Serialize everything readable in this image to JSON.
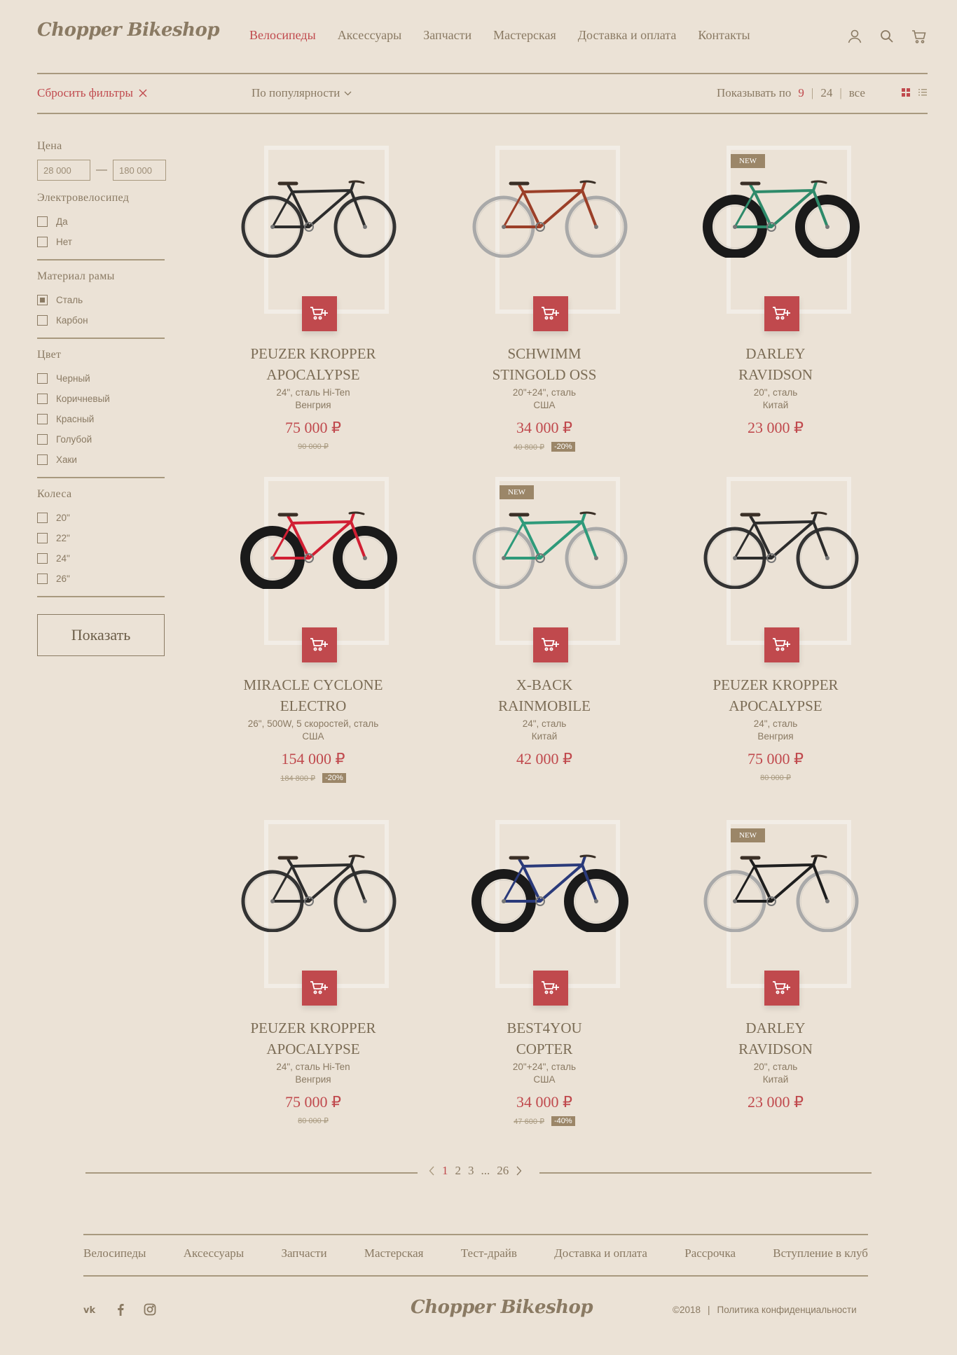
{
  "header": {
    "logo": "Chopper Bikeshop",
    "nav": [
      {
        "label": "Велосипеды",
        "active": true
      },
      {
        "label": "Аксессуары",
        "active": false
      },
      {
        "label": "Запчасти",
        "active": false
      },
      {
        "label": "Мастерская",
        "active": false
      },
      {
        "label": "Доставка и оплата",
        "active": false
      },
      {
        "label": "Контакты",
        "active": false
      }
    ],
    "icons": [
      "user-icon",
      "search-icon",
      "cart-icon"
    ]
  },
  "toolbar": {
    "reset_label": "Сбросить фильтры",
    "sort_label": "По популярности",
    "per_page_label": "Показывать по",
    "per_page_options": [
      "9",
      "24",
      "все"
    ],
    "per_page_active": "9",
    "view_modes": [
      "grid-view-icon",
      "list-view-icon"
    ]
  },
  "filters": {
    "price": {
      "title": "Цена",
      "min": "28 000",
      "max": "180 000"
    },
    "electric": {
      "title": "Электровелосипед",
      "options": [
        {
          "label": "Да",
          "checked": false
        },
        {
          "label": "Нет",
          "checked": false
        }
      ]
    },
    "frame": {
      "title": "Материал рамы",
      "options": [
        {
          "label": "Сталь",
          "checked": true
        },
        {
          "label": "Карбон",
          "checked": false
        }
      ]
    },
    "color": {
      "title": "Цвет",
      "options": [
        {
          "label": "Черный",
          "checked": false
        },
        {
          "label": "Коричневый",
          "checked": false
        },
        {
          "label": "Красный",
          "checked": false
        },
        {
          "label": "Голубой",
          "checked": false
        },
        {
          "label": "Хаки",
          "checked": false
        }
      ]
    },
    "wheels": {
      "title": "Колеса",
      "options": [
        {
          "label": "20\"",
          "checked": false
        },
        {
          "label": "22\"",
          "checked": false
        },
        {
          "label": "24\"",
          "checked": false
        },
        {
          "label": "26\"",
          "checked": false
        }
      ]
    },
    "show_button": "Показать"
  },
  "products": [
    {
      "name1": "PEUZER KROPPER",
      "name2": "APOCALYPSE",
      "spec1": "24\", сталь Hi-Ten",
      "spec2": "Венгрия",
      "price": "75 000 ₽",
      "old_price": "90 000 ₽",
      "discount": "",
      "new": false,
      "frame_color": "#2c2c2c",
      "tire_color": "#333333",
      "fat": false
    },
    {
      "name1": "SCHWIMM",
      "name2": "STINGOLD OSS",
      "spec1": "20\"+24\", сталь",
      "spec2": "США",
      "price": "34 000 ₽",
      "old_price": "40 800 ₽",
      "discount": "-20%",
      "new": false,
      "frame_color": "#9b3f28",
      "tire_color": "#a9a9a9",
      "fat": false
    },
    {
      "name1": "DARLEY",
      "name2": "RAVIDSON",
      "spec1": "20\", сталь",
      "spec2": "Китай",
      "price": "23 000 ₽",
      "old_price": "",
      "discount": "",
      "new": true,
      "frame_color": "#2e8a6a",
      "tire_color": "#1a1a1a",
      "fat": true
    },
    {
      "name1": "MIRACLE CYCLONE",
      "name2": "ELECTRO",
      "spec1": "26\", 500W, 5 скоростей, сталь",
      "spec2": "США",
      "price": "154 000 ₽",
      "old_price": "184 800 ₽",
      "discount": "-20%",
      "new": false,
      "frame_color": "#d11f33",
      "tire_color": "#1a1a1a",
      "fat": true
    },
    {
      "name1": "X-BACK",
      "name2": "RAINMOBILE",
      "spec1": "24\", сталь",
      "spec2": "Китай",
      "price": "42 000 ₽",
      "old_price": "",
      "discount": "",
      "new": true,
      "frame_color": "#2e9a7a",
      "tire_color": "#a9a9a9",
      "fat": false
    },
    {
      "name1": "PEUZER KROPPER",
      "name2": "APOCALYPSE",
      "spec1": "24\", сталь",
      "spec2": "Венгрия",
      "price": "75 000 ₽",
      "old_price": "80 000 ₽",
      "discount": "",
      "new": false,
      "frame_color": "#2c2c2c",
      "tire_color": "#333333",
      "fat": false
    },
    {
      "name1": "PEUZER KROPPER",
      "name2": "APOCALYPSE",
      "spec1": "24\", сталь Hi-Ten",
      "spec2": "Венгрия",
      "price": "75 000 ₽",
      "old_price": "80 000 ₽",
      "discount": "",
      "new": false,
      "frame_color": "#2c2c2c",
      "tire_color": "#333333",
      "fat": false
    },
    {
      "name1": "BEST4YOU",
      "name2": "COPTER",
      "spec1": "20\"+24\", сталь",
      "spec2": "США",
      "price": "34 000 ₽",
      "old_price": "47 600 ₽",
      "discount": "-40%",
      "new": false,
      "frame_color": "#2a3a7a",
      "tire_color": "#1a1a1a",
      "fat": true
    },
    {
      "name1": "DARLEY",
      "name2": "RAVIDSON",
      "spec1": "20\", сталь",
      "spec2": "Китай",
      "price": "23 000 ₽",
      "old_price": "",
      "discount": "",
      "new": true,
      "frame_color": "#1e1e1e",
      "tire_color": "#a9a9a9",
      "fat": false
    }
  ],
  "labels": {
    "new_badge": "NEW"
  },
  "pagination": {
    "pages": [
      "1",
      "2",
      "3",
      "...",
      "26"
    ],
    "active": "1"
  },
  "footer": {
    "nav": [
      "Велосипеды",
      "Аксессуары",
      "Запчасти",
      "Мастерская",
      "Тест-драйв",
      "Доставка и оплата",
      "Рассрочка",
      "Вступление в клуб"
    ],
    "socials": [
      "vk-icon",
      "facebook-icon",
      "instagram-icon"
    ],
    "logo": "Chopper Bikeshop",
    "copyright": "©2018",
    "divider": "|",
    "privacy": "Политика конфиденциальности"
  },
  "colors": {
    "background": "#ebe2d6",
    "accent": "#c0494d",
    "text": "#8a7a63",
    "badge": "#9b8668"
  }
}
